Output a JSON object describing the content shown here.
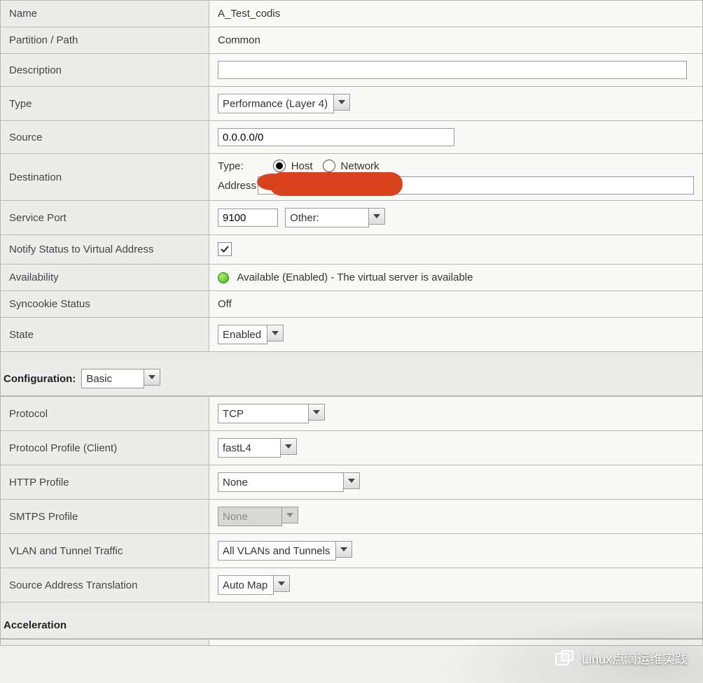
{
  "general": {
    "name_label": "Name",
    "name_value": "A_Test_codis",
    "partition_label": "Partition / Path",
    "partition_value": "Common",
    "description_label": "Description",
    "description_value": "",
    "type_label": "Type",
    "type_value": "Performance (Layer 4)",
    "source_label": "Source",
    "source_value": "0.0.0.0/0",
    "destination_label": "Destination",
    "dest_type_label": "Type:",
    "dest_type_host": "Host",
    "dest_type_network": "Network",
    "dest_address_label": "Address",
    "service_port_label": "Service Port",
    "service_port_value": "9100",
    "service_port_select": "Other:",
    "notify_label": "Notify Status to Virtual Address",
    "availability_label": "Availability",
    "availability_value": "Available (Enabled) - The virtual server is available",
    "syncookie_label": "Syncookie Status",
    "syncookie_value": "Off",
    "state_label": "State",
    "state_value": "Enabled"
  },
  "configuration": {
    "section_label": "Configuration:",
    "section_value": "Basic",
    "protocol_label": "Protocol",
    "protocol_value": "TCP",
    "protocol_profile_label": "Protocol Profile (Client)",
    "protocol_profile_value": "fastL4",
    "http_profile_label": "HTTP Profile",
    "http_profile_value": "None",
    "smtps_label": "SMTPS Profile",
    "smtps_value": "None",
    "vlan_label": "VLAN and Tunnel Traffic",
    "vlan_value": "All VLANs and Tunnels",
    "snat_label": "Source Address Translation",
    "snat_value": "Auto Map"
  },
  "acceleration": {
    "section_label": "Acceleration"
  },
  "watermark": {
    "text": "Linux点滴运维实践"
  }
}
